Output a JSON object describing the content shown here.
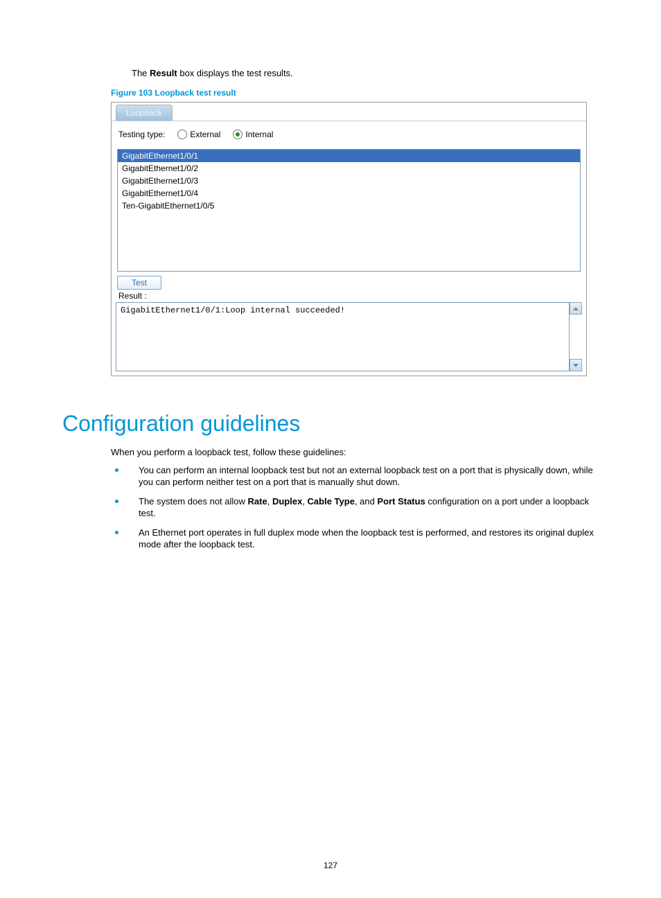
{
  "intro": {
    "prefix": "The ",
    "bold": "Result",
    "suffix": " box displays the test results."
  },
  "figure_caption": "Figure 103 Loopback test result",
  "tab_label": "Loopback",
  "testing_type_label": "Testing type:",
  "radio_external": "External",
  "radio_internal": "Internal",
  "ports": [
    "GigabitEthernet1/0/1",
    "GigabitEthernet1/0/2",
    "GigabitEthernet1/0/3",
    "GigabitEthernet1/0/4",
    "Ten-GigabitEthernet1/0/5"
  ],
  "selected_port_index": 0,
  "test_button": "Test",
  "result_label": "Result :",
  "result_text": "GigabitEthernet1/0/1:Loop internal succeeded!",
  "heading": "Configuration guidelines",
  "guidelines_intro": "When you perform a loopback test, follow these guidelines:",
  "bullet1": "You can perform an internal loopback test but not an external loopback test on a port that is physically down, while you can perform neither test on a port that is manually shut down.",
  "bullet2": {
    "p1": "The system does not allow ",
    "b1": "Rate",
    "s1": ", ",
    "b2": "Duplex",
    "s2": ", ",
    "b3": "Cable Type",
    "s3": ", and ",
    "b4": "Port Status",
    "p2": " configuration on a port under a loopback test."
  },
  "bullet3": "An Ethernet port operates in full duplex mode when the loopback test is performed, and restores its original duplex mode after the loopback test.",
  "page_number": "127"
}
